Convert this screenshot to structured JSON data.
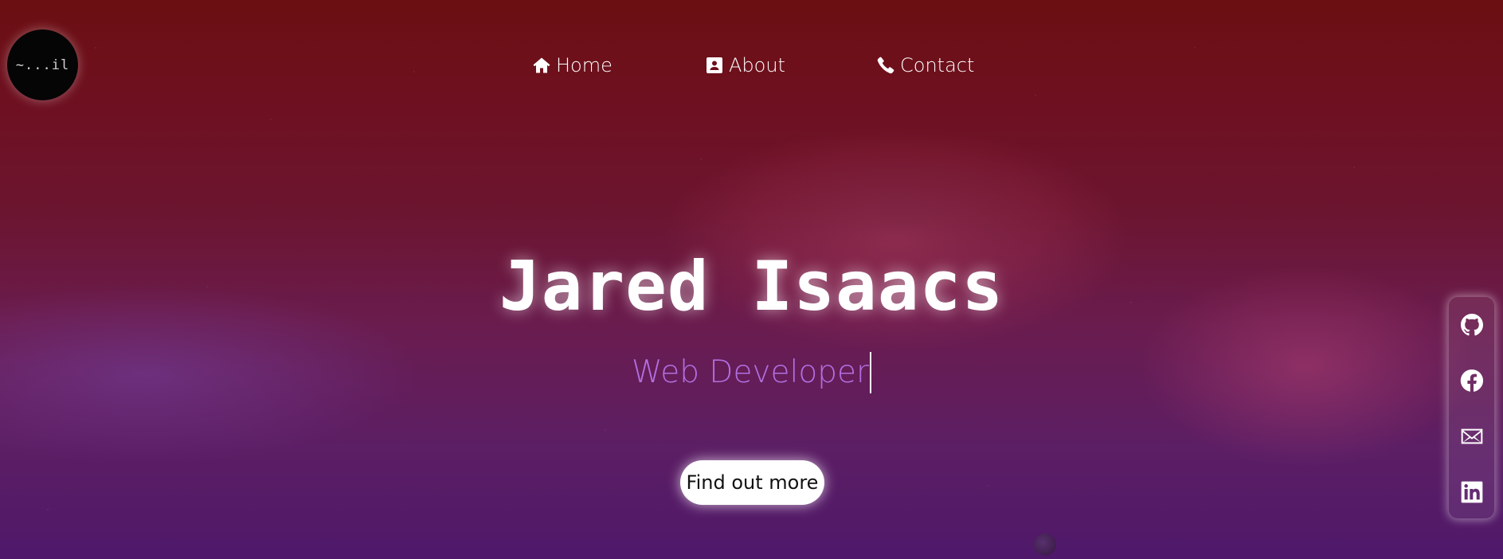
{
  "logo": {
    "text": "~...il"
  },
  "nav": {
    "items": [
      {
        "label": "Home",
        "icon": "home-icon"
      },
      {
        "label": "About",
        "icon": "contact-card-icon"
      },
      {
        "label": "Contact",
        "icon": "phone-icon"
      }
    ]
  },
  "hero": {
    "name": "Jared Isaacs",
    "subtitle": "Web Developer",
    "cta_label": "Find out more"
  },
  "social": {
    "links": [
      {
        "icon": "github-icon"
      },
      {
        "icon": "facebook-icon"
      },
      {
        "icon": "mail-icon"
      },
      {
        "icon": "linkedin-icon"
      }
    ]
  },
  "colors": {
    "subtitle": "#b16fe0",
    "background_top": "#6c0f12",
    "background_bottom": "#4f186a",
    "button_bg": "#ffffff"
  }
}
